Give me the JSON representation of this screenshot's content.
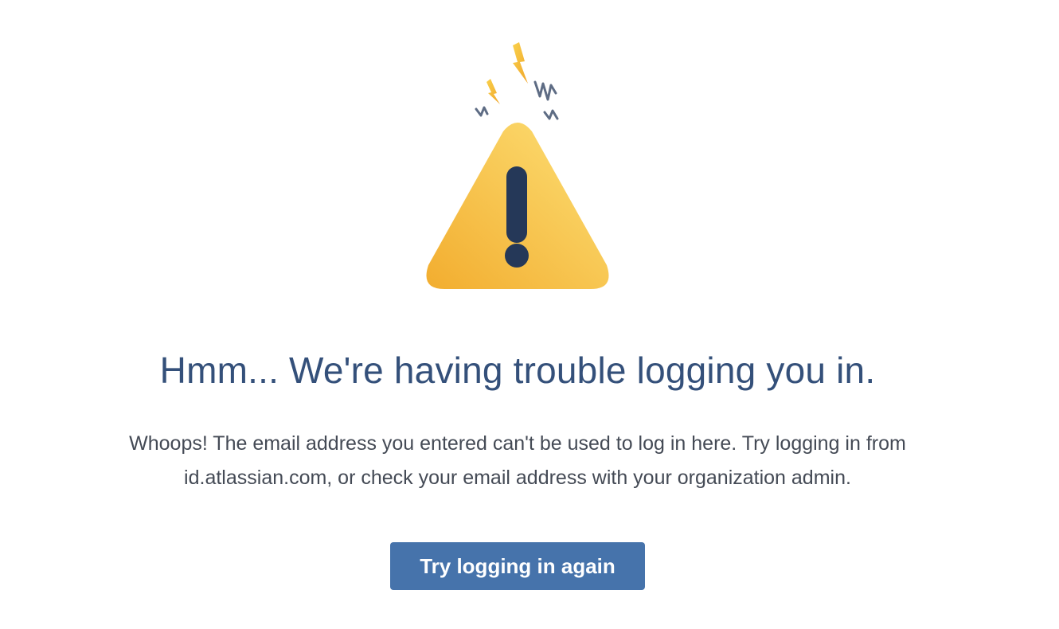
{
  "error": {
    "icon": "warning-triangle-icon",
    "heading": "Hmm... We're having trouble logging you in.",
    "message_line_1": "Whoops! The email address you entered can't be used to log in here. Try logging in from",
    "message_line_2": "id.atlassian.com, or check your email address with your organization admin.",
    "retry_label": "Try logging in again"
  },
  "colors": {
    "heading": "#34507a",
    "message": "#444a55",
    "button": "#4673ab",
    "warning_yellow": "#f7c948",
    "warning_orange": "#f2ad2f",
    "exclamation": "#253858"
  }
}
